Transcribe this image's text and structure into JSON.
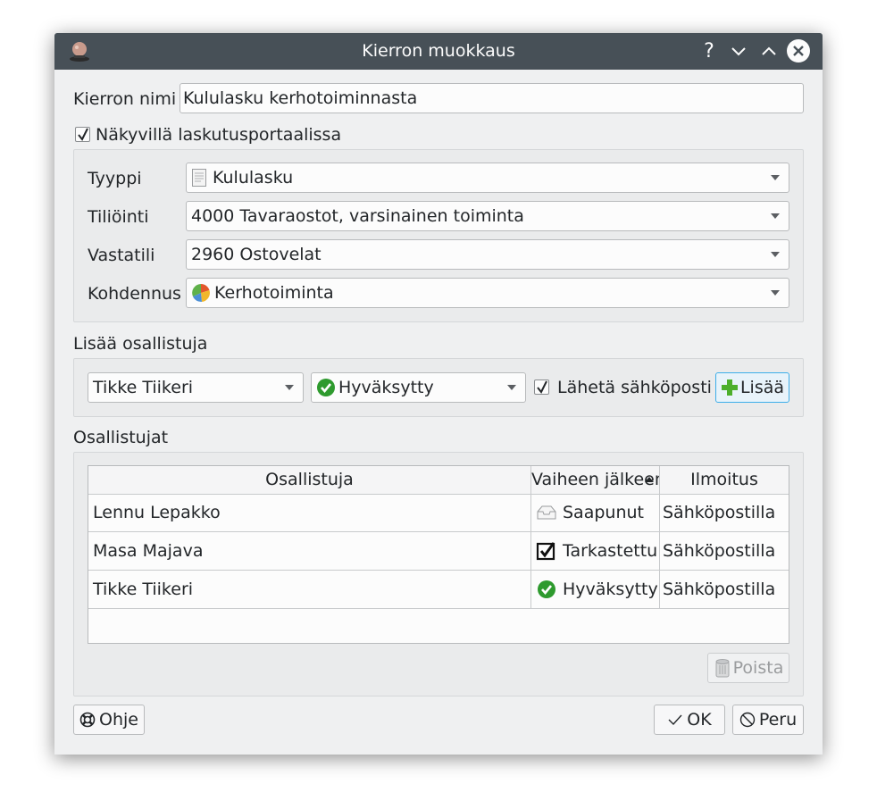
{
  "window": {
    "title": "Kierron muokkaus",
    "help_button": "?",
    "icons": [
      "app-icon",
      "help-icon",
      "minimize-icon",
      "maximize-icon",
      "close-icon"
    ]
  },
  "form": {
    "name_label": "Kierron nimi",
    "name_value": "Kululasku kerhotoiminnasta",
    "portal_checkbox_label": "Näkyvillä laskutusportaalissa",
    "portal_checked": true,
    "type_label": "Tyyppi",
    "type_value": "Kululasku",
    "account_label": "Tiliöinti",
    "account_value": "4000 Tavaraostot, varsinainen toiminta",
    "counter_label": "Vastatili",
    "counter_value": "2960 Ostovelat",
    "allocation_label": "Kohdennus",
    "allocation_value": "Kerhotoiminta"
  },
  "add_participant": {
    "section_label": "Lisää osallistuja",
    "person_value": "Tikke Tiikeri",
    "status_value": "Hyväksytty",
    "email_checkbox_label": "Lähetä sähköposti",
    "email_checked": true,
    "add_button": "Lisää"
  },
  "participants": {
    "section_label": "Osallistujat",
    "columns": [
      "Osallistuja",
      "Vaiheen jälkeen",
      "Ilmoitus"
    ],
    "rows": [
      {
        "name": "Lennu Lepakko",
        "status": "Saapunut",
        "status_icon": "inbox-icon",
        "notify": "Sähköpostilla"
      },
      {
        "name": "Masa Majava",
        "status": "Tarkastettu",
        "status_icon": "checked-box-icon",
        "notify": "Sähköpostilla"
      },
      {
        "name": "Tikke Tiikeri",
        "status": "Hyväksytty",
        "status_icon": "approved-icon",
        "notify": "Sähköpostilla"
      }
    ],
    "remove_button": "Poista"
  },
  "footer": {
    "help_button": "Ohje",
    "ok_button": "OK",
    "cancel_button": "Peru"
  },
  "colors": {
    "titlebar": "#475057",
    "window_bg": "#eff0f1",
    "accent": "#3daee9",
    "add_green": "#4caf2c",
    "approved_green": "#2e9a2e"
  }
}
